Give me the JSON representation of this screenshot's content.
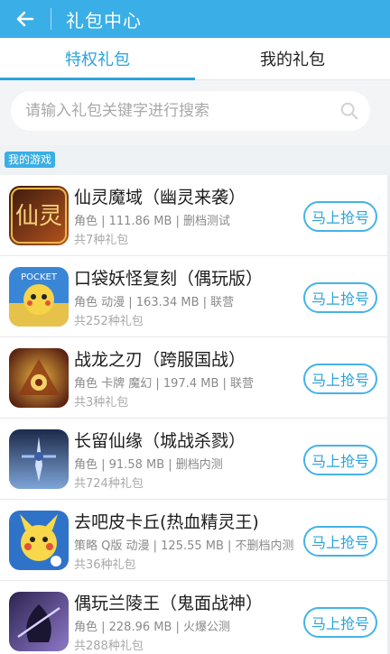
{
  "header": {
    "title": "礼包中心",
    "back_icon": "arrow-left-icon"
  },
  "tabs": [
    {
      "label": "特权礼包",
      "active": true
    },
    {
      "label": "我的礼包",
      "active": false
    }
  ],
  "search": {
    "placeholder": "请输入礼包关键字进行搜索",
    "value": "",
    "icon": "search-icon"
  },
  "section": {
    "label": "我的游戏"
  },
  "games": [
    {
      "name": "仙灵魔域（幽灵来袭）",
      "meta": "角色 | 111.86 MB | 删档测试",
      "count": "共7种礼包",
      "button": "马上抢号",
      "icon_colors": [
        "#3a1a0e",
        "#b7541e"
      ]
    },
    {
      "name": "口袋妖怪复刻（偶玩版）",
      "meta": "角色  动漫 | 163.34 MB | 联营",
      "count": "共252种礼包",
      "button": "马上抢号",
      "icon_colors": [
        "#f7d347",
        "#3a86d6"
      ]
    },
    {
      "name": "战龙之刃（跨服国战）",
      "meta": "角色  卡牌  魔幻 | 197.4 MB | 联营",
      "count": "共3种礼包",
      "button": "马上抢号",
      "icon_colors": [
        "#5a2312",
        "#e8b040"
      ]
    },
    {
      "name": "长留仙缘（城战杀戮）",
      "meta": "角色 | 91.58 MB | 删档内测",
      "count": "共724种礼包",
      "button": "马上抢号",
      "icon_colors": [
        "#1c2a4a",
        "#7ea4d8"
      ]
    },
    {
      "name": "去吧皮卡丘(热血精灵王)",
      "meta": "策略  Q版  动漫 | 125.55 MB | 不删档内测",
      "count": "共36种礼包",
      "button": "马上抢号",
      "icon_colors": [
        "#f8d84a",
        "#2f73c9"
      ]
    },
    {
      "name": "偶玩兰陵王（鬼面战神）",
      "meta": "角色 | 228.96 MB | 火爆公测",
      "count": "共288种礼包",
      "button": "马上抢号",
      "icon_colors": [
        "#2d2450",
        "#8d78c8"
      ]
    }
  ]
}
